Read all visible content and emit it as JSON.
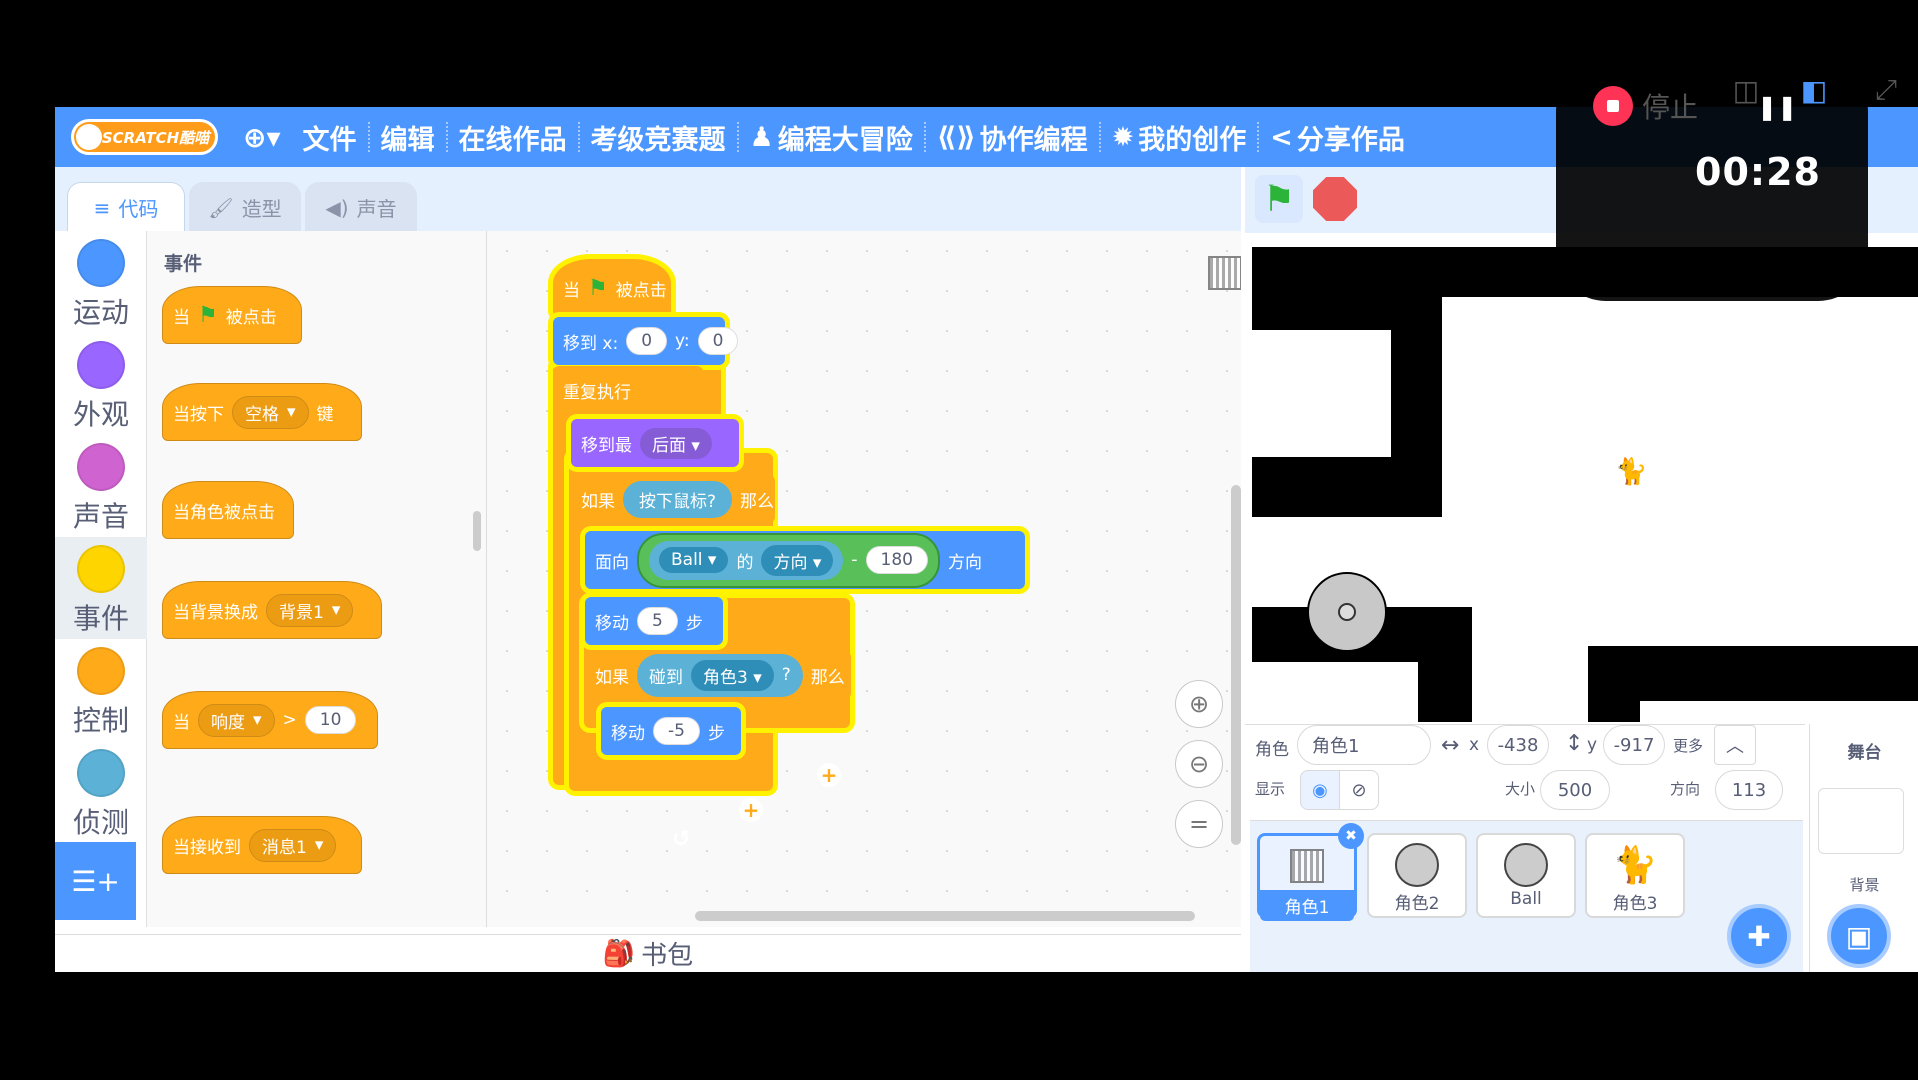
{
  "menu": {
    "logo": "SCRATCH酷喵",
    "items": [
      "文件",
      "编辑",
      "在线作品",
      "考级竞赛题",
      "编程大冒险",
      "协作编程",
      "我的创作",
      "分享作品"
    ]
  },
  "tabs": {
    "code": "代码",
    "costumes": "造型",
    "sounds": "声音"
  },
  "categories": [
    {
      "label": "运动",
      "color": "#4c97ff"
    },
    {
      "label": "外观",
      "color": "#9966ff"
    },
    {
      "label": "声音",
      "color": "#cf63cf"
    },
    {
      "label": "事件",
      "color": "#ffd500"
    },
    {
      "label": "控制",
      "color": "#ffab19"
    },
    {
      "label": "侦测",
      "color": "#5cb1d6"
    }
  ],
  "palette": {
    "title": "事件",
    "b1": {
      "when": "当",
      "clicked": "被点击"
    },
    "b2": {
      "when": "当按下",
      "key": "空格",
      "suffix": "键"
    },
    "b3": {
      "label": "当角色被点击"
    },
    "b4": {
      "label": "当背景换成",
      "backdrop": "背景1"
    },
    "b5": {
      "when": "当",
      "sensor": "响度",
      "op": ">",
      "value": "10"
    },
    "b6": {
      "label": "当接收到",
      "msg": "消息1"
    }
  },
  "script": {
    "hat": {
      "when": "当",
      "clicked": "被点击"
    },
    "goto": {
      "label": "移到 x:",
      "x": "0",
      "ylabel": "y:",
      "y": "0"
    },
    "forever": "重复执行",
    "layer": {
      "label": "移到最",
      "value": "后面"
    },
    "if1": {
      "label": "如果",
      "cond": "按下鼠标?",
      "then": "那么"
    },
    "point": {
      "label": "面向",
      "sprite": "Ball",
      "of": "的",
      "prop": "方向",
      "minus": "-",
      "value": "180",
      "suffix": "方向"
    },
    "move1": {
      "label": "移动",
      "value": "5",
      "suffix": "步"
    },
    "if2": {
      "label": "如果",
      "touch": "碰到",
      "target": "角色3",
      "q": "?",
      "then": "那么"
    },
    "move2": {
      "label": "移动",
      "value": "-5",
      "suffix": "步"
    }
  },
  "backpack": "书包",
  "recorder": {
    "stop_label": "停止",
    "timer": "00:28"
  },
  "sprite_info": {
    "sprite_label": "角色",
    "sprite_name": "角色1",
    "x_label": "x",
    "x": "-438",
    "y_label": "y",
    "y": "-917",
    "more": "更多",
    "show_label": "显示",
    "size_label": "大小",
    "size": "500",
    "direction_label": "方向",
    "direction": "113"
  },
  "sprites": [
    {
      "name": "角色1"
    },
    {
      "name": "角色2"
    },
    {
      "name": "Ball"
    },
    {
      "name": "角色3"
    }
  ],
  "stage_panel": {
    "title": "舞台",
    "backdrop_label": "背景"
  }
}
